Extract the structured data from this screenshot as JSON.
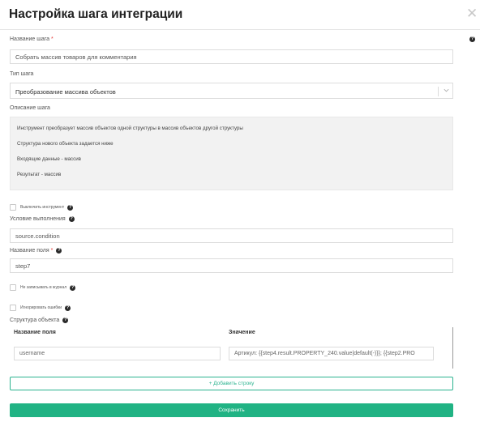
{
  "modal": {
    "title": "Настройка шага интеграции",
    "close_glyph": "✕"
  },
  "step_name": {
    "label": "Название шага",
    "required_mark": "*",
    "value": "Собрать массив товаров для комментария"
  },
  "step_type": {
    "label": "Тип шага",
    "selected": "Преобразование массива объектов"
  },
  "description": {
    "label": "Описание шага",
    "lines": [
      "Инструмент преобразует массив объектов одной структуры в массив объектов другой структуры",
      "Структура нового объекта задается ниже",
      "Входящие данные - массив",
      "Результат - массив"
    ]
  },
  "disable_tool": {
    "label": "Выключить инструмент",
    "checked": false
  },
  "condition": {
    "label": "Условие выполнения",
    "value": "source.condition"
  },
  "field_name": {
    "label": "Название поля",
    "required_mark": "*",
    "value": "step7"
  },
  "no_log": {
    "label": "Не записывать в журнал",
    "checked": false
  },
  "ignore_errors": {
    "label": "Игнорировать ошибки",
    "checked": false
  },
  "structure": {
    "label": "Структура объекта",
    "columns": [
      "Название поля",
      "Значение"
    ],
    "rows": [
      {
        "name": "username",
        "value": "Артикул: {{step4.result.PROPERTY_240.value|default(-)}}; {{step2.PRO"
      }
    ]
  },
  "buttons": {
    "add_row": "+ Добавить строку",
    "save": "Сохранить"
  },
  "colors": {
    "accent": "#21b384",
    "required": "#e53935"
  },
  "icons": {
    "help": "question-circle-icon",
    "close": "close-icon",
    "chevron": "chevron-down-icon"
  }
}
